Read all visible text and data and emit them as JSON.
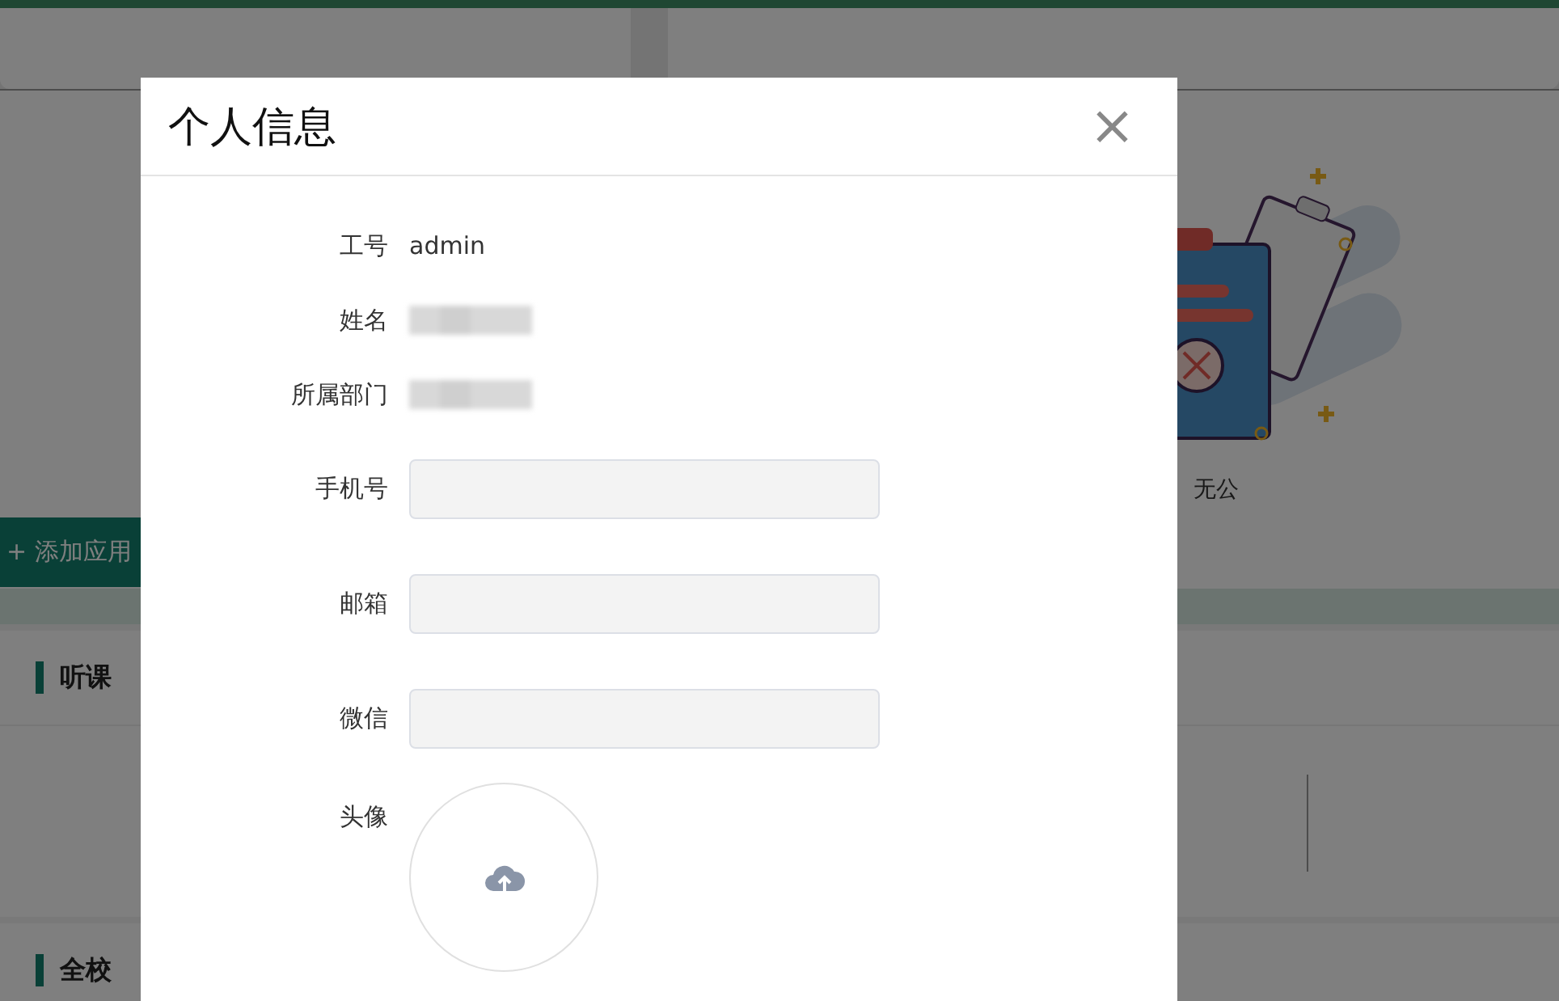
{
  "background": {
    "add_app_button": "+ 添加应用",
    "sections": [
      {
        "title": "听课"
      },
      {
        "title": "全校"
      }
    ],
    "notice_empty": "无公"
  },
  "dialog": {
    "title": "个人信息",
    "close": "×",
    "fields": [
      {
        "kind": "text",
        "label": "工号",
        "value": "admin"
      },
      {
        "kind": "redacted",
        "label": "姓名"
      },
      {
        "kind": "redacted",
        "label": "所属部门"
      },
      {
        "kind": "input",
        "label": "手机号"
      },
      {
        "kind": "input",
        "label": "邮箱"
      },
      {
        "kind": "input",
        "label": "微信"
      },
      {
        "kind": "avatar",
        "label": "头像"
      }
    ]
  }
}
